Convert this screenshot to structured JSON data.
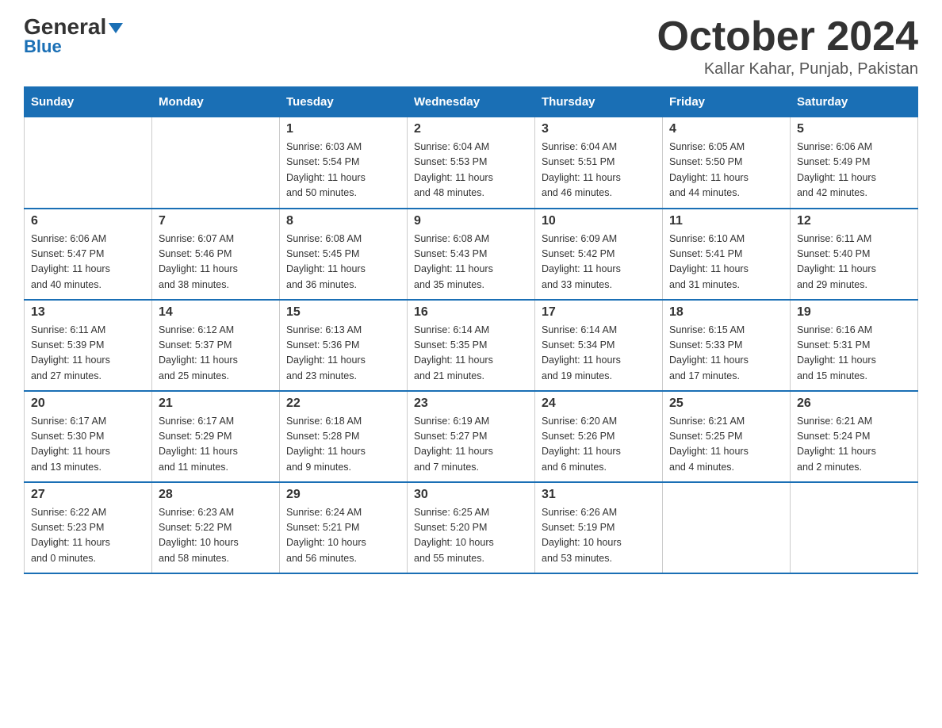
{
  "header": {
    "logo_general": "General",
    "logo_blue": "Blue",
    "month_title": "October 2024",
    "location": "Kallar Kahar, Punjab, Pakistan"
  },
  "days_of_week": [
    "Sunday",
    "Monday",
    "Tuesday",
    "Wednesday",
    "Thursday",
    "Friday",
    "Saturday"
  ],
  "weeks": [
    [
      {
        "day": "",
        "info": ""
      },
      {
        "day": "",
        "info": ""
      },
      {
        "day": "1",
        "info": "Sunrise: 6:03 AM\nSunset: 5:54 PM\nDaylight: 11 hours\nand 50 minutes."
      },
      {
        "day": "2",
        "info": "Sunrise: 6:04 AM\nSunset: 5:53 PM\nDaylight: 11 hours\nand 48 minutes."
      },
      {
        "day": "3",
        "info": "Sunrise: 6:04 AM\nSunset: 5:51 PM\nDaylight: 11 hours\nand 46 minutes."
      },
      {
        "day": "4",
        "info": "Sunrise: 6:05 AM\nSunset: 5:50 PM\nDaylight: 11 hours\nand 44 minutes."
      },
      {
        "day": "5",
        "info": "Sunrise: 6:06 AM\nSunset: 5:49 PM\nDaylight: 11 hours\nand 42 minutes."
      }
    ],
    [
      {
        "day": "6",
        "info": "Sunrise: 6:06 AM\nSunset: 5:47 PM\nDaylight: 11 hours\nand 40 minutes."
      },
      {
        "day": "7",
        "info": "Sunrise: 6:07 AM\nSunset: 5:46 PM\nDaylight: 11 hours\nand 38 minutes."
      },
      {
        "day": "8",
        "info": "Sunrise: 6:08 AM\nSunset: 5:45 PM\nDaylight: 11 hours\nand 36 minutes."
      },
      {
        "day": "9",
        "info": "Sunrise: 6:08 AM\nSunset: 5:43 PM\nDaylight: 11 hours\nand 35 minutes."
      },
      {
        "day": "10",
        "info": "Sunrise: 6:09 AM\nSunset: 5:42 PM\nDaylight: 11 hours\nand 33 minutes."
      },
      {
        "day": "11",
        "info": "Sunrise: 6:10 AM\nSunset: 5:41 PM\nDaylight: 11 hours\nand 31 minutes."
      },
      {
        "day": "12",
        "info": "Sunrise: 6:11 AM\nSunset: 5:40 PM\nDaylight: 11 hours\nand 29 minutes."
      }
    ],
    [
      {
        "day": "13",
        "info": "Sunrise: 6:11 AM\nSunset: 5:39 PM\nDaylight: 11 hours\nand 27 minutes."
      },
      {
        "day": "14",
        "info": "Sunrise: 6:12 AM\nSunset: 5:37 PM\nDaylight: 11 hours\nand 25 minutes."
      },
      {
        "day": "15",
        "info": "Sunrise: 6:13 AM\nSunset: 5:36 PM\nDaylight: 11 hours\nand 23 minutes."
      },
      {
        "day": "16",
        "info": "Sunrise: 6:14 AM\nSunset: 5:35 PM\nDaylight: 11 hours\nand 21 minutes."
      },
      {
        "day": "17",
        "info": "Sunrise: 6:14 AM\nSunset: 5:34 PM\nDaylight: 11 hours\nand 19 minutes."
      },
      {
        "day": "18",
        "info": "Sunrise: 6:15 AM\nSunset: 5:33 PM\nDaylight: 11 hours\nand 17 minutes."
      },
      {
        "day": "19",
        "info": "Sunrise: 6:16 AM\nSunset: 5:31 PM\nDaylight: 11 hours\nand 15 minutes."
      }
    ],
    [
      {
        "day": "20",
        "info": "Sunrise: 6:17 AM\nSunset: 5:30 PM\nDaylight: 11 hours\nand 13 minutes."
      },
      {
        "day": "21",
        "info": "Sunrise: 6:17 AM\nSunset: 5:29 PM\nDaylight: 11 hours\nand 11 minutes."
      },
      {
        "day": "22",
        "info": "Sunrise: 6:18 AM\nSunset: 5:28 PM\nDaylight: 11 hours\nand 9 minutes."
      },
      {
        "day": "23",
        "info": "Sunrise: 6:19 AM\nSunset: 5:27 PM\nDaylight: 11 hours\nand 7 minutes."
      },
      {
        "day": "24",
        "info": "Sunrise: 6:20 AM\nSunset: 5:26 PM\nDaylight: 11 hours\nand 6 minutes."
      },
      {
        "day": "25",
        "info": "Sunrise: 6:21 AM\nSunset: 5:25 PM\nDaylight: 11 hours\nand 4 minutes."
      },
      {
        "day": "26",
        "info": "Sunrise: 6:21 AM\nSunset: 5:24 PM\nDaylight: 11 hours\nand 2 minutes."
      }
    ],
    [
      {
        "day": "27",
        "info": "Sunrise: 6:22 AM\nSunset: 5:23 PM\nDaylight: 11 hours\nand 0 minutes."
      },
      {
        "day": "28",
        "info": "Sunrise: 6:23 AM\nSunset: 5:22 PM\nDaylight: 10 hours\nand 58 minutes."
      },
      {
        "day": "29",
        "info": "Sunrise: 6:24 AM\nSunset: 5:21 PM\nDaylight: 10 hours\nand 56 minutes."
      },
      {
        "day": "30",
        "info": "Sunrise: 6:25 AM\nSunset: 5:20 PM\nDaylight: 10 hours\nand 55 minutes."
      },
      {
        "day": "31",
        "info": "Sunrise: 6:26 AM\nSunset: 5:19 PM\nDaylight: 10 hours\nand 53 minutes."
      },
      {
        "day": "",
        "info": ""
      },
      {
        "day": "",
        "info": ""
      }
    ]
  ]
}
